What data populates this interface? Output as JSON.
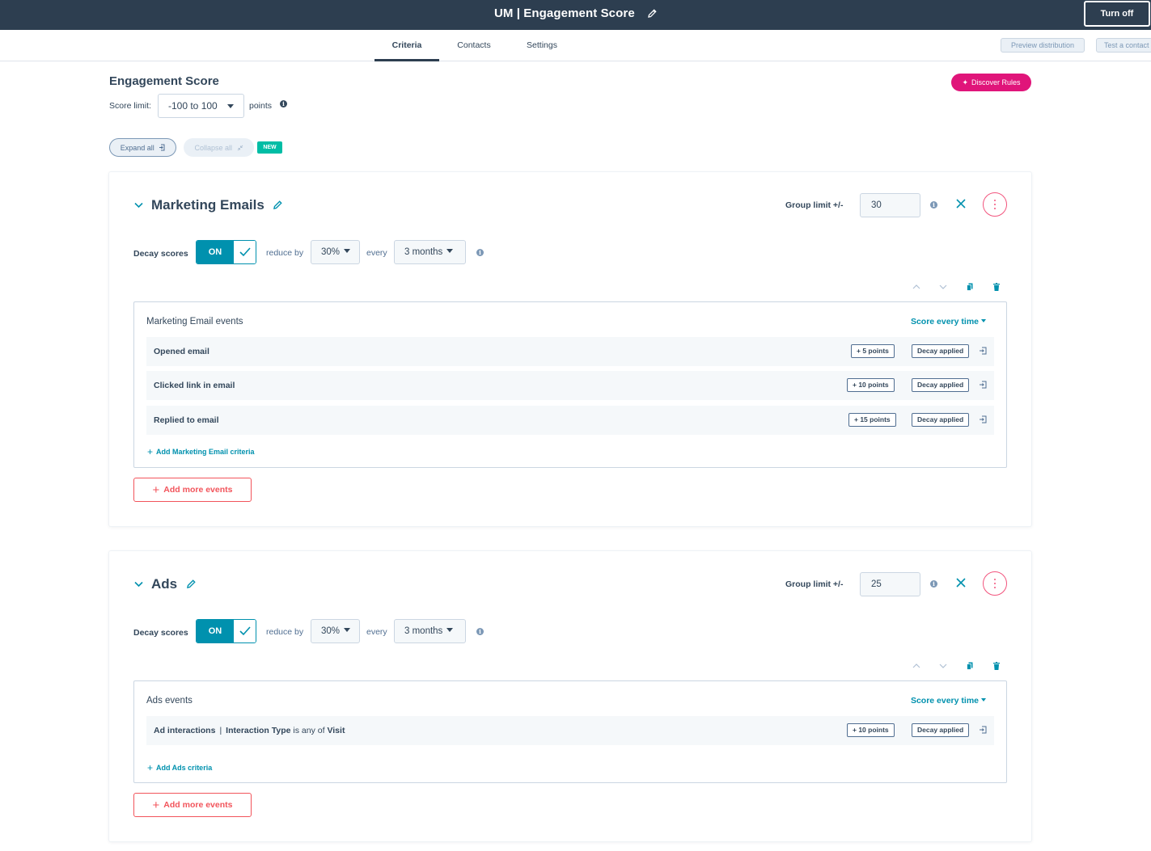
{
  "topbar": {
    "title": "UM | Engagement Score",
    "turn_off": "Turn off"
  },
  "tabs": [
    {
      "label": "Criteria",
      "active": true
    },
    {
      "label": "Contacts",
      "active": false
    },
    {
      "label": "Settings",
      "active": false
    }
  ],
  "tab_actions": {
    "preview": "Preview distribution",
    "test": "Test a contact"
  },
  "header": {
    "title": "Engagement Score",
    "score_limit_label": "Score limit:",
    "score_limit_value": "-100 to 100",
    "points_label": "points",
    "discover_rules": "Discover Rules",
    "expand_all": "Expand all",
    "collapse_all": "Collapse all",
    "new_badge": "NEW"
  },
  "groups": [
    {
      "title": "Marketing Emails",
      "group_limit_label": "Group limit +/-",
      "group_limit_value": "30",
      "decay_label": "Decay scores",
      "decay_toggle": "ON",
      "reduce_by_label": "reduce by",
      "reduce_by_value": "30%",
      "every_label": "every",
      "every_value": "3 months",
      "events_title": "Marketing Email events",
      "score_mode": "Score every time",
      "events": [
        {
          "name": "Opened email",
          "points": "+ 5 points",
          "decay": "Decay applied"
        },
        {
          "name": "Clicked link in email",
          "points": "+ 10 points",
          "decay": "Decay applied"
        },
        {
          "name": "Replied to email",
          "points": "+ 15 points",
          "decay": "Decay applied"
        }
      ],
      "add_criteria": "Add Marketing Email criteria",
      "add_more_events": "Add more events"
    },
    {
      "title": "Ads",
      "group_limit_label": "Group limit +/-",
      "group_limit_value": "25",
      "decay_label": "Decay scores",
      "decay_toggle": "ON",
      "reduce_by_label": "reduce by",
      "reduce_by_value": "30%",
      "every_label": "every",
      "every_value": "3 months",
      "events_title": "Ads events",
      "score_mode": "Score every time",
      "events": [
        {
          "name": "Ad interactions",
          "sep": "|",
          "filter_prop": "Interaction Type",
          "filter_op": "is any of",
          "filter_val": "Visit",
          "points": "+ 10 points",
          "decay": "Decay applied"
        }
      ],
      "add_criteria": "Add Ads criteria",
      "add_more_events": "Add more events"
    }
  ],
  "colors": {
    "topbar": "#2d3e50",
    "accent_teal": "#0091ae",
    "accent_pink": "#e0157a",
    "accent_coral": "#f2545b",
    "new_badge": "#00bda5"
  },
  "icons": [
    "pencil-icon",
    "info-icon",
    "chevron-down-icon",
    "close-icon",
    "more-vertical-icon",
    "arrow-up-icon",
    "arrow-down-icon",
    "copy-icon",
    "trash-icon",
    "check-icon",
    "plus-icon",
    "login-icon",
    "expand-icon",
    "collapse-icon",
    "sparkle-icon"
  ]
}
